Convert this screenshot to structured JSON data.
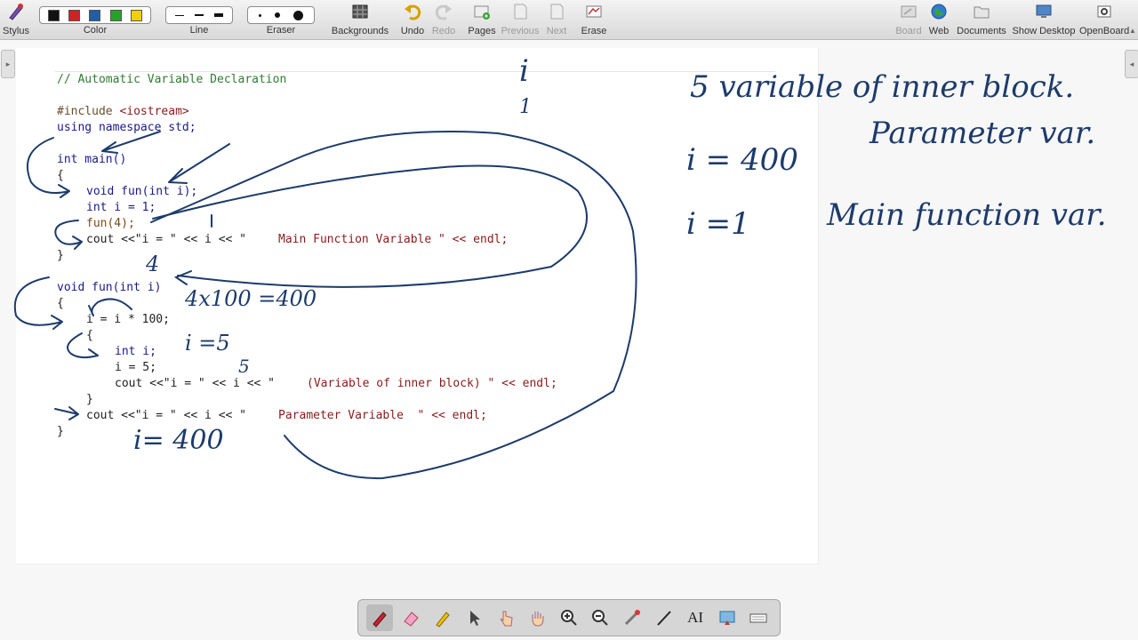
{
  "toolbar": {
    "stylus": "Stylus",
    "color": "Color",
    "line": "Line",
    "eraser": "Eraser",
    "backgrounds": "Backgrounds",
    "undo": "Undo",
    "redo": "Redo",
    "pages": "Pages",
    "previous": "Previous",
    "next": "Next",
    "erase": "Erase",
    "board": "Board",
    "web": "Web",
    "documents": "Documents",
    "show_desktop": "Show Desktop",
    "openboard": "OpenBoard",
    "colors": [
      "#111111",
      "#d32020",
      "#1f5fa8",
      "#2aa02a",
      "#f0d000"
    ]
  },
  "code": {
    "comment": "// Automatic Variable Declaration",
    "include_kw": "#include",
    "include_lib": "<iostream>",
    "using_line": "using namespace std;",
    "main_sig": "int main()",
    "brace_open": "{",
    "brace_close": "}",
    "decl_fun": "void fun(int i);",
    "int_i": "int i = 1;",
    "call_fun": "fun(4);",
    "cout_main_a": "cout <<\"i = \" << i << \"",
    "cout_main_b": "Main Function Variable \" << endl;",
    "fun_sig": "void fun(int i)",
    "i_mul": "i = i * 100;",
    "inner_int": "int i;",
    "inner_assign": "i = 5;",
    "cout_inner_a": "cout <<\"i = \" << i << \"",
    "cout_inner_b": "(Variable of inner block) \" << endl;",
    "cout_param_a": "cout <<\"i = \" << i << \"",
    "cout_param_b": "Parameter Variable  \" << endl;"
  },
  "ink_notes": {
    "top_i": "i",
    "top_one": "1",
    "four": "4",
    "calc": "4x100 =400",
    "i_eq_5": "i =5",
    "five": "5",
    "i_eq_400": "i= 400",
    "right_line1": "5 variable of inner block.",
    "right_line2_a": "i = 400",
    "right_line2_b": "Parameter var.",
    "right_line3_a": "i =1",
    "right_line3_b": "Main function var."
  },
  "palette": {
    "tools": [
      "pen-icon",
      "eraser-icon",
      "marker-icon",
      "selector-icon",
      "interact-icon",
      "hand-icon",
      "zoom-in-icon",
      "zoom-out-icon",
      "laser-pointer-icon",
      "line-icon",
      "text-icon",
      "capture-icon",
      "keyboard-icon"
    ],
    "text_tool_label": "AI"
  }
}
